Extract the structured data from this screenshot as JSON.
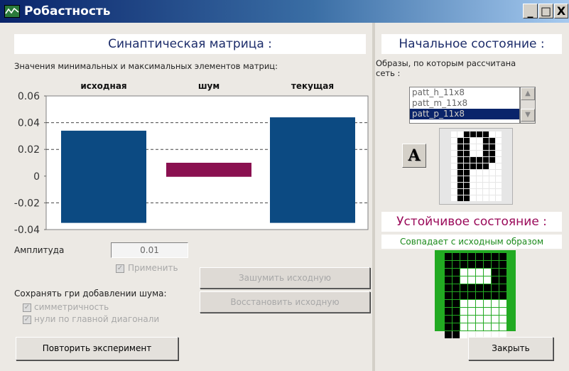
{
  "window": {
    "title": "Робастность",
    "minimize": "_",
    "maximize": "□",
    "close": "X"
  },
  "matrix": {
    "header": "Синаптическая матрица :",
    "caption": "Значения минимальных и максимальных элементов матриц:",
    "amplitude_label": "Амплитуда",
    "amplitude_value": "0.01",
    "apply_label": "Применить",
    "add_noise_btn": "Зашумить исходную",
    "restore_btn": "Восстановить исходную",
    "keep_label": "Сохранять гри добавлении шума:",
    "symmetry_label": "симметричность",
    "zeros_label": "нули по главной диагонали",
    "repeat_btn": "Повторить эксперимент"
  },
  "chart_data": {
    "type": "bar",
    "categories": [
      "исходная",
      "шум",
      "текущая"
    ],
    "series": [
      {
        "values_max": [
          0.034,
          0.01,
          0.044
        ],
        "values_min": [
          -0.035,
          -0.0005,
          -0.035
        ]
      }
    ],
    "bar_colors": [
      "#0c4a82",
      "#8a1050",
      "#0c4a82"
    ],
    "yticks": [
      "0.06",
      "0.04",
      "0.02",
      "0",
      "-0.02",
      "-0.04"
    ],
    "ylim": [
      -0.04,
      0.06
    ],
    "grid": "dashed at 0.04, 0.02, -0.02"
  },
  "initial": {
    "header": "Начальное состояние :",
    "caption_line1": "Образы, по которым рассчитана",
    "caption_line2": "сеть :",
    "patterns": [
      "patt_h_11x8",
      "patt_m_11x8",
      "patt_p_11x8"
    ],
    "selected": "patt_p_11x8",
    "font_btn": "A"
  },
  "stable": {
    "header": "Устойчивое состояние :",
    "status": "Совпадает с исходным образом"
  },
  "close_btn": "Закрыть",
  "colors": {
    "accent_blue": "#1c2c6a",
    "stable_header": "#9a0a5a",
    "status_green": "#1a8a1a",
    "grid_green": "#22aa22"
  },
  "grid_start": [
    "00111100",
    "01100110",
    "01100110",
    "01100110",
    "01111110",
    "01111100",
    "01100000",
    "01100000",
    "01100000",
    "01100000",
    "01100000"
  ],
  "grid_stable": [
    "11111111",
    "11111111",
    "11000011",
    "11000011",
    "11111111",
    "11111111",
    "11000000",
    "11000000",
    "11000000",
    "11000000",
    "11000000"
  ]
}
